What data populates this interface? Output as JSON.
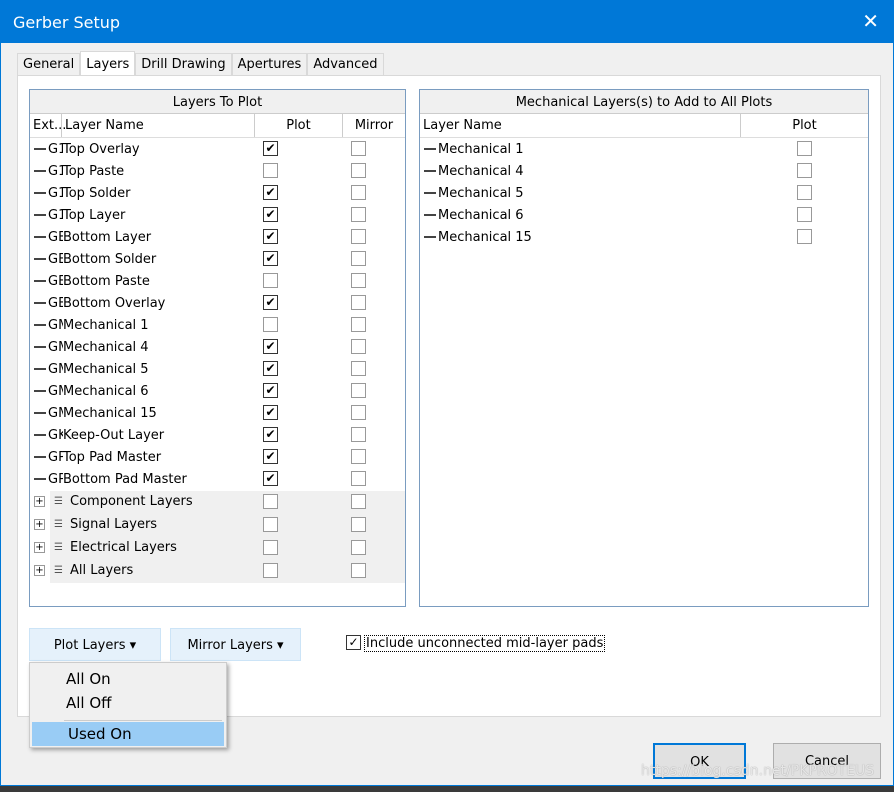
{
  "window": {
    "title": "Gerber Setup",
    "close": "✕"
  },
  "tabs": [
    "General",
    "Layers",
    "Drill Drawing",
    "Apertures",
    "Advanced"
  ],
  "left": {
    "title": "Layers To Plot",
    "columns": [
      "Ext...",
      "Layer Name",
      "Plot",
      "Mirror"
    ],
    "rows": [
      {
        "ext": "G1",
        "name": "Top Overlay",
        "plot": true,
        "mirror": false
      },
      {
        "ext": "G1",
        "name": "Top Paste",
        "plot": false,
        "mirror": false
      },
      {
        "ext": "G1",
        "name": "Top Solder",
        "plot": true,
        "mirror": false
      },
      {
        "ext": "G1",
        "name": "Top Layer",
        "plot": true,
        "mirror": false
      },
      {
        "ext": "GE",
        "name": "Bottom Layer",
        "plot": true,
        "mirror": false
      },
      {
        "ext": "GE",
        "name": "Bottom Solder",
        "plot": true,
        "mirror": false
      },
      {
        "ext": "GE",
        "name": "Bottom Paste",
        "plot": false,
        "mirror": false
      },
      {
        "ext": "GE",
        "name": "Bottom Overlay",
        "plot": true,
        "mirror": false
      },
      {
        "ext": "GM",
        "name": "Mechanical 1",
        "plot": false,
        "mirror": false
      },
      {
        "ext": "GM",
        "name": "Mechanical 4",
        "plot": true,
        "mirror": false
      },
      {
        "ext": "GM",
        "name": "Mechanical 5",
        "plot": true,
        "mirror": false
      },
      {
        "ext": "GM",
        "name": "Mechanical 6",
        "plot": true,
        "mirror": false
      },
      {
        "ext": "GM",
        "name": "Mechanical 15",
        "plot": true,
        "mirror": false
      },
      {
        "ext": "GK",
        "name": "Keep-Out Layer",
        "plot": true,
        "mirror": false
      },
      {
        "ext": "GP",
        "name": "Top Pad Master",
        "plot": true,
        "mirror": false
      },
      {
        "ext": "GP",
        "name": "Bottom Pad Master",
        "plot": true,
        "mirror": false
      }
    ],
    "groups": [
      "Component Layers",
      "Signal Layers",
      "Electrical Layers",
      "All Layers"
    ]
  },
  "right": {
    "title": "Mechanical Layers(s) to Add to All Plots",
    "columns": [
      "Layer Name",
      "Plot"
    ],
    "rows": [
      "Mechanical 1",
      "Mechanical 4",
      "Mechanical 5",
      "Mechanical 6",
      "Mechanical 15"
    ]
  },
  "buttons": {
    "plot_layers": "Plot Layers ▾",
    "mirror_layers": "Mirror Layers ▾",
    "ok": "OK",
    "cancel": "Cancel"
  },
  "include_pads": {
    "label": "Include unconnected mid-layer pads",
    "checked": true
  },
  "menu": {
    "items": [
      "All On",
      "All Off",
      "Used On"
    ],
    "highlighted": "Used On"
  },
  "watermark": "https://blog.csdn.net/PKPROTEUS"
}
